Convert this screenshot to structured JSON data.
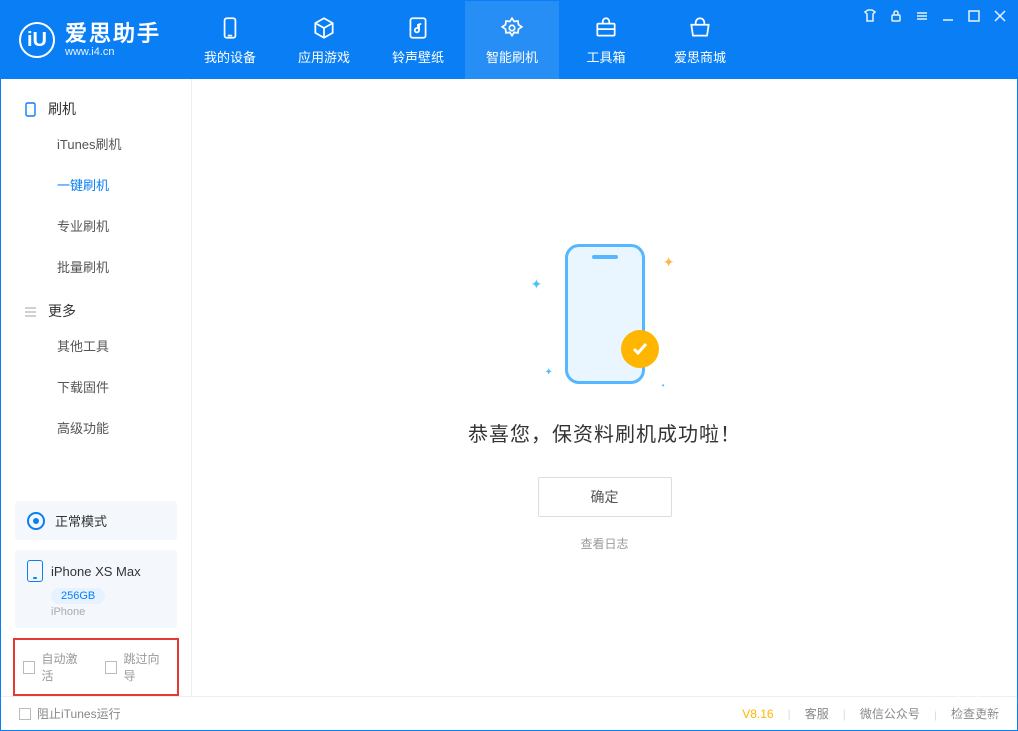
{
  "brand": {
    "title": "爱思助手",
    "subtitle": "www.i4.cn",
    "logo_letter": "iU"
  },
  "tabs": [
    {
      "label": "我的设备",
      "icon": "device"
    },
    {
      "label": "应用游戏",
      "icon": "cube"
    },
    {
      "label": "铃声壁纸",
      "icon": "music"
    },
    {
      "label": "智能刷机",
      "icon": "gear",
      "active": true
    },
    {
      "label": "工具箱",
      "icon": "toolbox"
    },
    {
      "label": "爱思商城",
      "icon": "cart"
    }
  ],
  "sidebar": {
    "group1": {
      "title": "刷机",
      "items": [
        "iTunes刷机",
        "一键刷机",
        "专业刷机",
        "批量刷机"
      ],
      "active_index": 1
    },
    "group2": {
      "title": "更多",
      "items": [
        "其他工具",
        "下载固件",
        "高级功能"
      ]
    }
  },
  "status": {
    "label": "正常模式"
  },
  "device": {
    "name": "iPhone XS Max",
    "storage": "256GB",
    "type": "iPhone"
  },
  "options": {
    "auto_activate": "自动激活",
    "skip_guide": "跳过向导"
  },
  "main": {
    "success_message": "恭喜您，保资料刷机成功啦！",
    "ok_button": "确定",
    "view_log": "查看日志"
  },
  "footer": {
    "block_itunes": "阻止iTunes运行",
    "version": "V8.16",
    "support": "客服",
    "wechat": "微信公众号",
    "check_update": "检查更新"
  }
}
